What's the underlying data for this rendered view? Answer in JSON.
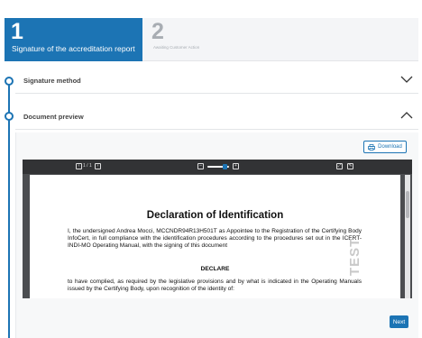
{
  "stepper": {
    "step1": {
      "number": "1",
      "label": "Signature of the accreditation report"
    },
    "step2": {
      "number": "2",
      "label": "Awaiting Customer Action"
    }
  },
  "sections": {
    "signature_method": "Signature method",
    "document_preview": "Document preview"
  },
  "preview": {
    "download_label": "Download",
    "download_icon": "printer-download-icon",
    "next_label": "Next"
  },
  "viewer": {
    "page_indicator": "1 / 1",
    "zoom_level": 0.8,
    "document": {
      "title": "Declaration of Identification",
      "paragraph1": "I, the undersigned  Andrea Mocci, MCCNDR94R13H501T as Appointee to the Registration of the Certifying Body InfoCert, in full compliance with the identification procedures according to the procedures set out in the ICERT-INDI-MO Operating Manual, with the signing of this document",
      "declare": "DECLARE",
      "paragraph2": "to have complied, as required by the legislative provisions and by what is indicated in the Operating Manuals issued by the Certifying Body, upon recognition of the identity of:",
      "watermark": "TEST"
    }
  },
  "colors": {
    "accent": "#1c74b4",
    "viewer_bg": "#4b4d50",
    "viewer_toolbar": "#323335"
  }
}
